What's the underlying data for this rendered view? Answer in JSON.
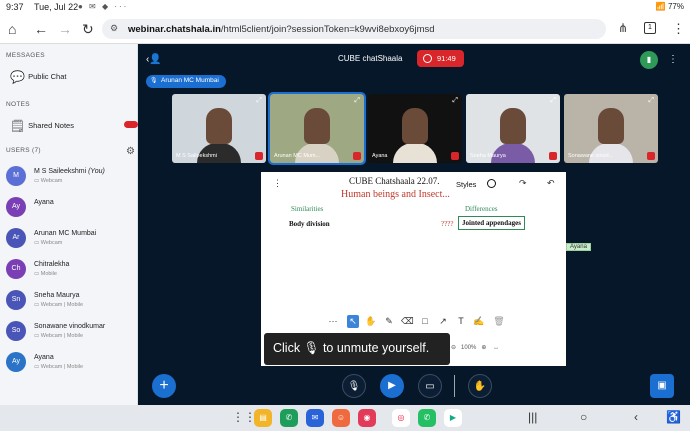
{
  "status_bar": {
    "time": "9:37",
    "date": "Tue, Jul 22",
    "battery": "77%"
  },
  "browser": {
    "url_domain": "webinar.chatshala.in",
    "url_path": "/html5client/join?sessionToken=k9wvi8ebxoy6jmsd",
    "tab_count": "1"
  },
  "sidebar": {
    "messages_header": "MESSAGES",
    "public_chat": "Public Chat",
    "notes_header": "NOTES",
    "shared_notes": "Shared Notes",
    "users_header": "USERS (7)",
    "users": [
      {
        "initials": "M",
        "name": "M S Saileekshmi",
        "you": "(You)",
        "sub": "Webcam",
        "color": "#5b6fd6"
      },
      {
        "initials": "Ay",
        "name": "Ayana",
        "sub": "",
        "color": "#7b3fb5"
      },
      {
        "initials": "Ar",
        "name": "Arunan MC Mumbai",
        "sub": "Webcam",
        "color": "#4a55b8"
      },
      {
        "initials": "Ch",
        "name": "Chitralekha",
        "sub": "Mobile",
        "color": "#7b3fb5"
      },
      {
        "initials": "Sn",
        "name": "Sneha Maurya",
        "sub": "Webcam | Mobile",
        "color": "#4a55b8"
      },
      {
        "initials": "So",
        "name": "Sonawane vinodkumar",
        "sub": "Webcam | Mobile",
        "color": "#4a55b8"
      },
      {
        "initials": "Ay",
        "name": "Ayana",
        "sub": "Webcam | Mobile",
        "color": "#2a73c7"
      }
    ]
  },
  "meeting": {
    "title": "CUBE chatShaala",
    "timer": "91:49",
    "presenter": "Arunan MC Mumbai"
  },
  "videos": [
    {
      "name": "M S Saileekshmi",
      "bg": "#cfd6dc",
      "body": "#2b2b2b"
    },
    {
      "name": "Arunan MC Mum...",
      "bg": "#9ea883",
      "body": "#d8d2c4"
    },
    {
      "name": "Ayana",
      "bg": "#111111",
      "body": "#e8e2d6"
    },
    {
      "name": "Sneha Maurya",
      "bg": "#dfe3e6",
      "body": "#7a5ba6"
    },
    {
      "name": "Sonawane vinod...",
      "bg": "#b9b3a8",
      "body": "#e6e6ea"
    }
  ],
  "whiteboard": {
    "title": "CUBE Chatshaala 22.07.",
    "subtitle": "Human beings and Insect...",
    "similarities": "Similarities",
    "differences": "Differences",
    "body_division": "Body division",
    "question": "????",
    "jointed": "Jointed appendages",
    "styles_label": "Styles",
    "zoom": "100%"
  },
  "unmute_toast": {
    "before": "Click",
    "after": "to unmute yourself."
  },
  "ayana_label": "Ayana",
  "colors": {
    "accent": "#1b6fd0",
    "danger": "#d9262b",
    "success": "#2e8b57"
  }
}
